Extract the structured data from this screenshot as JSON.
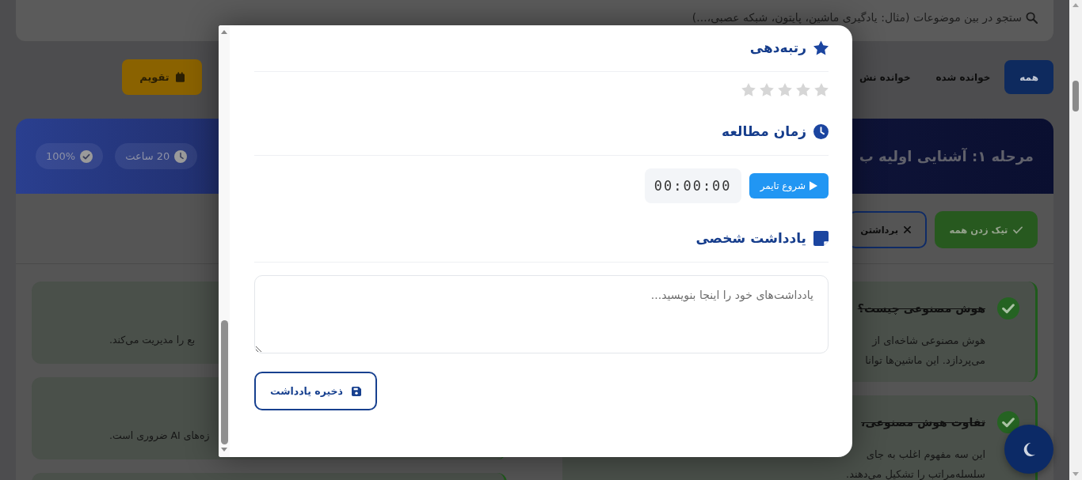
{
  "search": {
    "placeholder": "ستجو در بین موضوعات (مثال: یادگیری ماشین، پایتون، شبکه عصبی،...)"
  },
  "filters": [
    {
      "label": "همه",
      "selected": true
    },
    {
      "label": "خوانده شده",
      "selected": false
    },
    {
      "label": "خوانده نش",
      "selected": false
    }
  ],
  "calendar_button": {
    "label": "تقویم"
  },
  "stage": {
    "title": "مرحله ۱: آشنایی اولیه ب",
    "badges": [
      {
        "kind": "hours",
        "label": "20 ساعت"
      },
      {
        "kind": "progress",
        "label": "100%"
      }
    ]
  },
  "actions": [
    {
      "kind": "check_all",
      "label": "تیک زدن همه"
    },
    {
      "kind": "uncheck_all",
      "label": "برداشتن"
    }
  ],
  "columns": [
    {
      "cards": [
        {
          "title": "هوش مصنوعی چیست؟",
          "text": [
            "هوش مصنوعی شاخه‌ای از",
            "می‌پردازد. این ماشین‌ها توانا"
          ],
          "completed": true
        },
        {
          "title": "تفاوت هوش مصنوعی،",
          "text": [
            "این سه مفهوم اغلب به جای",
            "سلسله‌مراتب را تشکیل می‌دهند."
          ],
          "completed": true
        }
      ]
    },
    {
      "cards": [
        {
          "text": [
            "بع را مدیریت می‌کند."
          ],
          "completed": true
        },
        {
          "text": [
            "زه‌های AI ضروری است."
          ],
          "completed": true
        },
        {
          "completed": true
        }
      ]
    }
  ],
  "modal": {
    "rating": {
      "heading": "رتبه‌دهی",
      "stars": 0
    },
    "timer": {
      "heading": "زمان مطالعه",
      "start_button": "شروع تایمر",
      "display": "00:00:00"
    },
    "note": {
      "heading": "یادداشت شخصی",
      "placeholder": "یادداشت‌های خود را اینجا بنویسید...",
      "save_button": "ذخیره یادداشت"
    }
  }
}
